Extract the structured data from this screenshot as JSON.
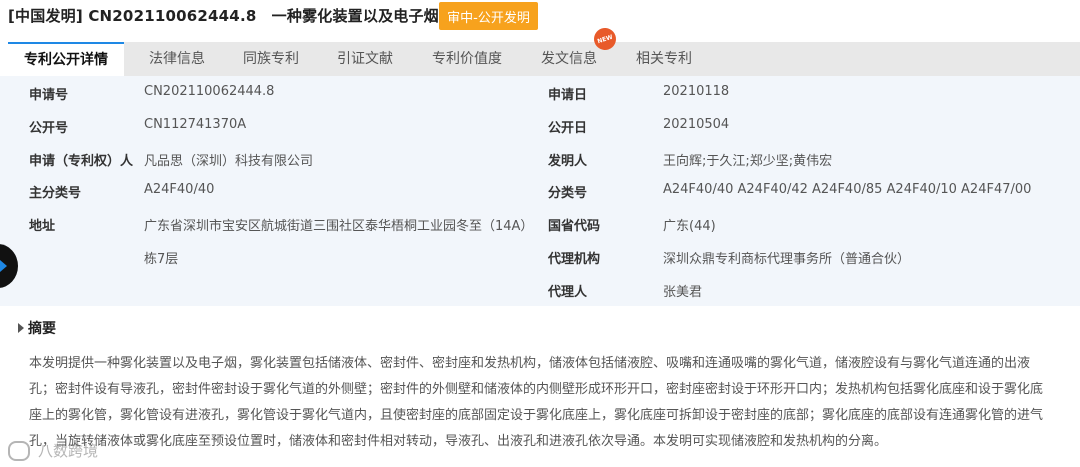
{
  "header": {
    "title": "[中国发明] CN202110062444.8　一种雾化装置以及电子烟",
    "status_label": "审中-公开发明"
  },
  "tabs": [
    {
      "label": "专利公开详情",
      "active": true
    },
    {
      "label": "法律信息"
    },
    {
      "label": "同族专利"
    },
    {
      "label": "引证文献"
    },
    {
      "label": "专利价值度"
    },
    {
      "label": "发文信息"
    },
    {
      "label": "相关专利"
    }
  ],
  "new_badge": "NEW",
  "fields": {
    "application_no": {
      "label": "申请号",
      "value": "CN202110062444.8"
    },
    "application_date": {
      "label": "申请日",
      "value": "20210118"
    },
    "publication_no": {
      "label": "公开号",
      "value": "CN112741370A"
    },
    "publication_date": {
      "label": "公开日",
      "value": "20210504"
    },
    "applicant": {
      "label": "申请（专利权）人",
      "value": "凡品思（深圳）科技有限公司"
    },
    "inventor": {
      "label": "发明人",
      "value": "王向辉;于久江;郑少坚;黄伟宏"
    },
    "main_class": {
      "label": "主分类号",
      "value": "A24F40/40"
    },
    "class_no": {
      "label": "分类号",
      "value": "A24F40/40 A24F40/42 A24F40/85 A24F40/10 A24F47/00"
    },
    "address": {
      "label": "地址",
      "value_line1": "广东省深圳市宝安区航城街道三围社区泰华梧桐工业园冬至（14A）",
      "value_line2": "栋7层"
    },
    "province_code": {
      "label": "国省代码",
      "value": "广东(44)"
    },
    "agency": {
      "label": "代理机构",
      "value": "深圳众鼎专利商标代理事务所（普通合伙）"
    },
    "agent": {
      "label": "代理人",
      "value": "张美君"
    }
  },
  "abstract": {
    "title": "摘要",
    "lines": [
      "本发明提供一种雾化装置以及电子烟，雾化装置包括储液体、密封件、密封座和发热机构，储液体包括储液腔、吸嘴和连通吸嘴的雾化气道，储液腔设有与雾化气道连通的出液",
      "孔；密封件设有导液孔，密封件密封设于雾化气道的外侧壁；密封件的外侧壁和储液体的内侧壁形成环形开口，密封座密封设于环形开口内；发热机构包括雾化底座和设于雾化底",
      "座上的雾化管，雾化管设有进液孔，雾化管设于雾化气道内，且使密封座的底部固定设于雾化底座上，雾化底座可拆卸设于密封座的底部；雾化底座的底部设有连通雾化管的进气",
      "孔，当旋转储液体或雾化底座至预设位置时，储液体和密封件相对转动，导液孔、出液孔和进液孔依次导通。本发明可实现储液腔和发热机构的分离。"
    ]
  },
  "watermark": "八数跨境",
  "colors": {
    "status_button": "#f7a21d",
    "tab_active_border": "#1e88e5",
    "detail_bg": "#f2f6fb",
    "badge": "#e85a2a"
  }
}
